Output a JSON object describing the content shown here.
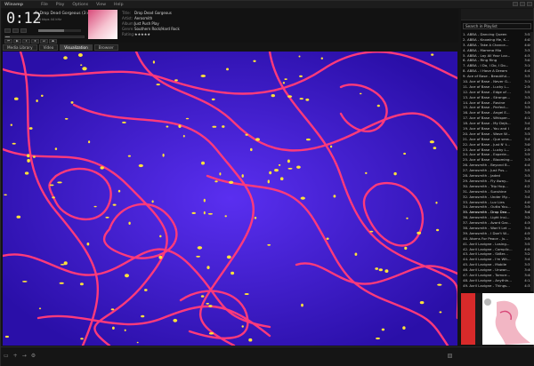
{
  "app": {
    "name": "Winamp",
    "menu": [
      "File",
      "Play",
      "Options",
      "View",
      "Help"
    ]
  },
  "player": {
    "time": "0:12",
    "track_line": "6. Drop Dead Gorgeous (3:42)",
    "bitrate": "128 kbps  44 kHz",
    "meta": [
      {
        "key": "Title:",
        "value": "Drop Dead Gorgeous"
      },
      {
        "key": "Artist:",
        "value": "Aerosmith"
      },
      {
        "key": "Album:",
        "value": "Just Push Play"
      },
      {
        "key": "Genre:",
        "value": "Southern Rock/Hard Rock"
      },
      {
        "key": "Rating:",
        "value": "★★★★★"
      }
    ],
    "transport": [
      "⏮",
      "▶",
      "⏸",
      "⏹",
      "⏭",
      "⏏"
    ],
    "volume_pct": 60,
    "seek_pct": 6
  },
  "tabs": [
    "Media Library",
    "Video",
    "Visualization",
    "Browser"
  ],
  "active_tab": "Visualization",
  "playlist": {
    "search_placeholder": "Search in Playlist",
    "items": [
      {
        "t": "1. ABBA - Dancing Queen",
        "d": "3:52"
      },
      {
        "t": "2. ABBA - Knowing Me, K...",
        "d": "4:02"
      },
      {
        "t": "3. ABBA - Take A Chance...",
        "d": "4:06"
      },
      {
        "t": "4. ABBA - Mamma Mia",
        "d": "3:33"
      },
      {
        "t": "5. ABBA - Lay All Your Lov...",
        "d": "4:35"
      },
      {
        "t": "6. ABBA - Ring Ring",
        "d": "3:03"
      },
      {
        "t": "7. ABBA - I Do, I Do, I Do...",
        "d": "3:16"
      },
      {
        "t": "8. ABBA - I Have A Dream",
        "d": "4:42"
      },
      {
        "t": "9. Ace of Base - Beautiful...",
        "d": "3:31"
      },
      {
        "t": "10. Ace of Base - Never G...",
        "d": "3:16"
      },
      {
        "t": "11. Ace of Base - Lucky L...",
        "d": "2:56"
      },
      {
        "t": "12. Ace of Base - Edge of ...",
        "d": "3:55"
      },
      {
        "t": "13. Ace of Base - Strange...",
        "d": "3:34"
      },
      {
        "t": "14. Ace of Base - Ravine",
        "d": "4:39"
      },
      {
        "t": "15. Ace of Base - Perfect...",
        "d": "3:56"
      },
      {
        "t": "16. Ace of Base - Angel E...",
        "d": "3:56"
      },
      {
        "t": "17. Ace of Base - Whisper...",
        "d": "4:14"
      },
      {
        "t": "18. Ace of Base - My Dejà...",
        "d": "3:41"
      },
      {
        "t": "19. Ace of Base - You and I",
        "d": "4:07"
      },
      {
        "t": "20. Ace of Base - Wave W...",
        "d": "3:38"
      },
      {
        "t": "21. Ace of Base - Que sera...",
        "d": "3:47"
      },
      {
        "t": "22. Ace of Base - Just N' t...",
        "d": "3:09"
      },
      {
        "t": "23. Ace of Base - Lucky L...",
        "d": "2:56"
      },
      {
        "t": "24. Ace of Base - Experie...",
        "d": "3:59"
      },
      {
        "t": "25. Ace of Base - Blooming...",
        "d": "3:36"
      },
      {
        "t": "26. Aerosmith - Beyond B...",
        "d": "4:45"
      },
      {
        "t": "27. Aerosmith - Just Pus...",
        "d": "3:51"
      },
      {
        "t": "28. Aerosmith - Jaded",
        "d": "3:34"
      },
      {
        "t": "29. Aerosmith - Fly Away...",
        "d": "3:42"
      },
      {
        "t": "30. Aerosmith - Trip Hop...",
        "d": "4:27"
      },
      {
        "t": "31. Aerosmith - Sunshine",
        "d": "3:37"
      },
      {
        "t": "32. Aerosmith - Under My...",
        "d": "3:47"
      },
      {
        "t": "33. Aerosmith - Luv Lies",
        "d": "4:09"
      },
      {
        "t": "34. Aerosmith - Outta You...",
        "d": "3:56"
      },
      {
        "t": "35. Aerosmith - Drop Dea...",
        "d": "3:42"
      },
      {
        "t": "36. Aerosmith - Light Insi...",
        "d": "3:24"
      },
      {
        "t": "37. Aerosmith - Avant Gar...",
        "d": "4:36"
      },
      {
        "t": "38. Aerosmith - Won't Let ...",
        "d": "3:48"
      },
      {
        "t": "39. Aerosmith - I Don't W...",
        "d": "4:59"
      },
      {
        "t": "40. Atoms For Peace - Ju...",
        "d": "3:50"
      },
      {
        "t": "41. Avril Lavigne - Losing...",
        "d": "3:53"
      },
      {
        "t": "42. Avril Lavigne - Complic...",
        "d": "4:04"
      },
      {
        "t": "43. Avril Lavigne - Sk8er...",
        "d": "3:24"
      },
      {
        "t": "44. Avril Lavigne - I'm Wit...",
        "d": "3:43"
      },
      {
        "t": "45. Avril Lavigne - Mobile",
        "d": "3:31"
      },
      {
        "t": "46. Avril Lavigne - Unwan...",
        "d": "3:40"
      },
      {
        "t": "47. Avril Lavigne - Tomorr...",
        "d": "3:48"
      },
      {
        "t": "48. Avril Lavigne - Anythin...",
        "d": "4:14"
      },
      {
        "t": "49. Avril Lavigne - Things...",
        "d": "4:32"
      }
    ]
  },
  "album_art": {
    "artist": "Aerosmith",
    "title": "Just Push Play"
  },
  "colors": {
    "viz_bg": "#3b1cd0",
    "viz_line": "#ff3a7a",
    "viz_dot": "#ffe23a",
    "accent": "#d84b7a"
  }
}
